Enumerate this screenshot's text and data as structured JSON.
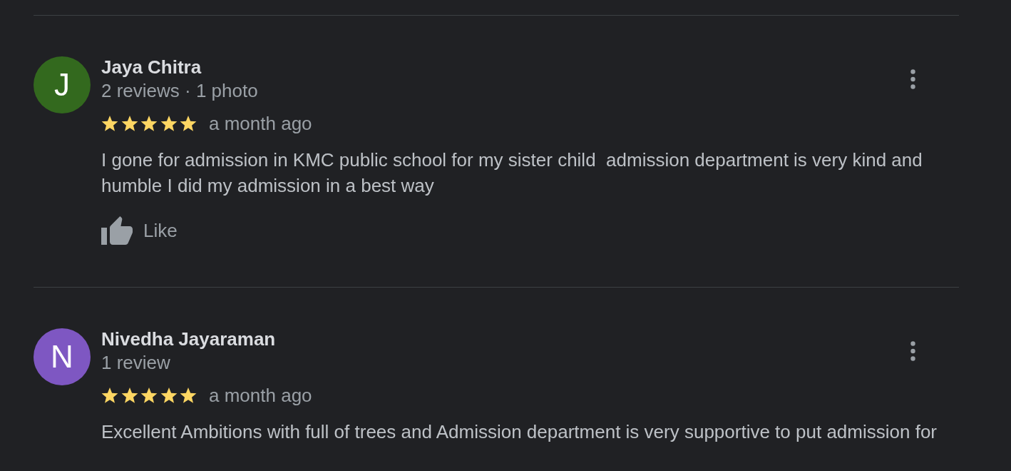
{
  "reviews": [
    {
      "avatar": {
        "letter": "J",
        "color": "#33691e"
      },
      "name": "Jaya Chitra",
      "meta": "2 reviews · 1 photo",
      "stars": 5,
      "time": "a month ago",
      "text": "I gone for admission in KMC public school for my sister child  admission department is very kind and humble I did my admission in a best way",
      "like": "Like"
    },
    {
      "avatar": {
        "letter": "N",
        "color": "#7e57c2"
      },
      "name": "Nivedha Jayaraman",
      "meta": "1 review",
      "stars": 5,
      "time": "a month ago",
      "text": "Excellent Ambitions with full of trees and Admission department is very supportive to put admission for"
    }
  ]
}
